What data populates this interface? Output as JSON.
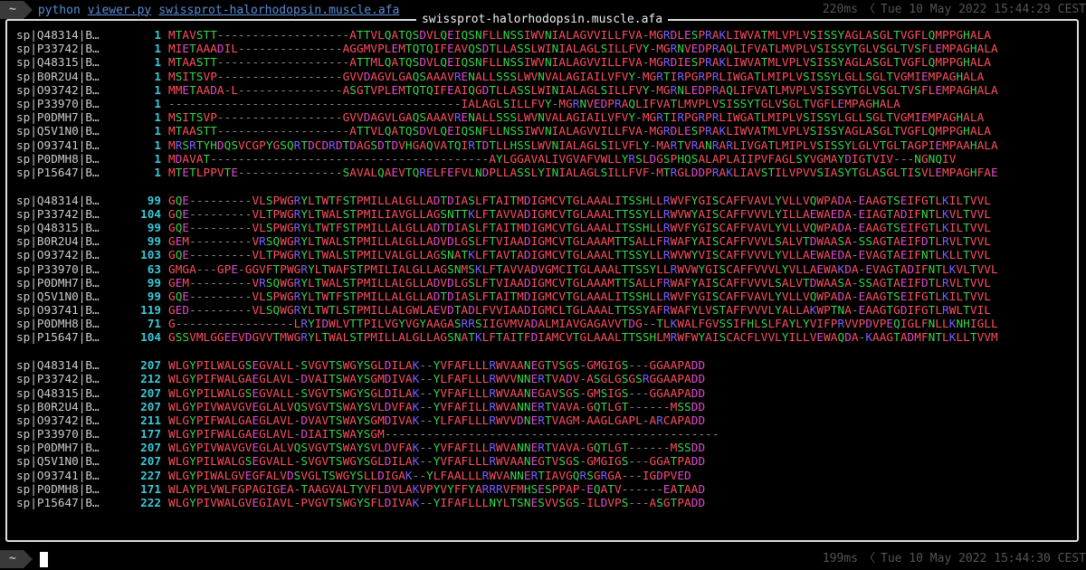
{
  "prompt": {
    "chip": "~",
    "program": "python",
    "script": "viewer.py",
    "file": "swissprot-halorhodopsin.muscle.afa"
  },
  "status_top": {
    "duration": "220ms",
    "timestamp": "Tue 10 May 2022 15:44:29 CEST"
  },
  "status_bottom": {
    "duration": "199ms",
    "timestamp": "Tue 10 May 2022 15:44:30 CEST"
  },
  "frame_title": "swissprot-halorhodopsin.muscle.afa",
  "colors": {
    "hydrophobic": "#ff4f5e",
    "polar": "#3bd34a",
    "positive": "#7a5cff",
    "negative": "#e04ad0",
    "gap": "#888888",
    "position": "#3ec7d6"
  },
  "blocks": [
    {
      "rows": [
        {
          "name": "sp|Q48314|B…",
          "pos": "1",
          "seq": "MTAVSTT-------------------ATTVLQATQSDVLQEIQSNFLLNSSIWVNIALAGVVILLFVA-MGRDLESPRAKLIWVATMLVPLVSISSYAGLASGLTVGFLQMPPGHALA"
        },
        {
          "name": "sp|P33742|B…",
          "pos": "1",
          "seq": "MIETAAADIL---------------AGGMVPLEMTQTQIFEAVQSDTLLASSLWINIALAGLSILLFVY-MGRNVEDPRAQLIFVATLMVPLVSISSYTGLVSGLTVSFLEMPAGHALA"
        },
        {
          "name": "sp|Q48315|B…",
          "pos": "1",
          "seq": "MTAASTT-------------------ATTMLQATQSDVLQEIQSNFLLNSSIWVNIALAGVVILLFVA-MGRDIESPRAKLIWVATMLVPLVSISSYAGLASGLTVGFLQMPPGHALA"
        },
        {
          "name": "sp|B0R2U4|B…",
          "pos": "1",
          "seq": "MSITSVP------------------GVVDAGVLGAQSAAAVRENALLSSSLWVNVALAGIAILVFVY-MGRTIRPGRPRLIWGATLMIPLVSISSYLGLLSGLTVGMIEMPAGHALA"
        },
        {
          "name": "sp|O93742|B…",
          "pos": "1",
          "seq": "MMETAADA-L---------------ASGTVPLEMTQTQIFEAIQGDTLLASSLWINIALAGLSILLFVY-MGRNLEDPRAQLIFVATLMVPLVSISSYTGLVSGLTVSFLEMPAGHALA"
        },
        {
          "name": "sp|P33970|B…",
          "pos": "1",
          "seq": "------------------------------------------IALAGLSILLFVY-MGRNVEDPRAQLIFVATLMVPLVSISSYTGLVSGLTVGFLEMPAGHALA"
        },
        {
          "name": "sp|P0DMH7|B…",
          "pos": "1",
          "seq": "MSITSVP------------------GVVDAGVLGAQSAAAVRENALLSSSLWVNVALAGIAILVFVY-MGRTIRPGRPRLIWGATLMIPLVSISSYLGLLSGLTVGMIEMPAGHALA"
        },
        {
          "name": "sp|Q5V1N0|B…",
          "pos": "1",
          "seq": "MTAASTT-------------------ATTVLQATQSDVLQEIQSNFLLNSSIWVNIALAGVVILLFVA-MGRDLESPRAKLIWVATMLVPLVSISSYAGLASGLTVGFLQMPPGHALA"
        },
        {
          "name": "sp|O93741|B…",
          "pos": "1",
          "seq": "MRSRTYHDQSVCGPYGSQRTDCDRDTDAGSDTDVHGAQVATQIRTDTLLHSSLWVNIALAGLSILVFLY-MARTVRANRARLIVGATLMIPLVSISSYLGLVTGLTAGPIEMPAAHALA"
        },
        {
          "name": "sp|P0DMH8|B…",
          "pos": "1",
          "seq": "MDAVAT----------------------------------------AYLGGAVALIVGVAFVWLLYRSLDGSPHQSALAPLAIIPVFAGLSYVGMAYDIGTVIV---NGNQIV"
        },
        {
          "name": "sp|P15647|B…",
          "pos": "1",
          "seq": "MTETLPPVTE---------------SAVALQAEVTQRELFEFVLNDPLLASSLYINIALAGLSILLFVF-MTRGLDDPRAKLIAVSTILVPVVSIASYTGLASGLTISVLEMPAGHFAE"
        }
      ]
    },
    {
      "rows": [
        {
          "name": "sp|Q48314|B…",
          "pos": "99",
          "seq": "GQE---------VLSPWGRYLTWTFSTPMILLALGLLADTDIASLFTAITMDIGMCVTGLAAALITSSHLLRWVFYGISCAFFVAVLYVLLVQWPADA-EAAGTSEIFGTLKILTVVL"
        },
        {
          "name": "sp|P33742|B…",
          "pos": "104",
          "seq": "GQE---------VLTPWGRYLTWALSTPMILIAVGLLAGSNTTKLFTAVVADIGMCVTGLAAALTTSSYLLRWVWYAISCAFFVVVLYILLAEWAEDA-EIAGTADIFNTLKVLTVVL"
        },
        {
          "name": "sp|Q48315|B…",
          "pos": "99",
          "seq": "GQE---------VLSPWGRYLTWTFSTPMILLALGLLADTDIASLFTAITMDIGMCVTGLAAALITSSHLLRWVFYGISCAFFVAVLYVLLVQWPADA-EAAGTSEIFGTLKILTVVL"
        },
        {
          "name": "sp|B0R2U4|B…",
          "pos": "99",
          "seq": "GEM---------VRSQWGRYLTWALSTPMILLALGLLADVDLGSLFTVIAADIGMCVTGLAAAMTTSALLFRWAFYAISCAFFVVVLSALVTDWAASA-SSAGTAEIFDTLRVLTVVL"
        },
        {
          "name": "sp|O93742|B…",
          "pos": "103",
          "seq": "GQE---------VLTPWGRYLTWALSTPMILVALGLLAGSNATKLFTAVTADIGMCVTGLAAALTTSSYLLRWVWYVISCAFFVVVLYVLLAEWAEDA-EVAGTAEIFNTLKLLTVVL"
        },
        {
          "name": "sp|P33970|B…",
          "pos": "63",
          "seq": "GMGA---GPE-GGVFTPWGRYLTWAFSTPMILIALGLLAGSNMSKLFTAVVADVGMCITGLAAALTTSSYLLRWVWYGISCAFFVVVLYVLLAEWAKDA-EVAGTADIFNTLKVLTVVL"
        },
        {
          "name": "sp|P0DMH7|B…",
          "pos": "99",
          "seq": "GEM---------VRSQWGRYLTWALSTPMILLALGLLADVDLGSLFTVIAADIGMCVTGLAAAMTTSALLFRWAFYAISCAFFVVVLSALVTDWAASA-SSAGTAEIFDTLRVLTVVL"
        },
        {
          "name": "sp|Q5V1N0|B…",
          "pos": "99",
          "seq": "GQE---------VLSPWGRYLTWTFSTPMILLALGLLADTDIASLFTAITMDIGMCVTGLAAALITSSHLLRWVFYGISCAFFVAVLYVLLVQWPADA-EAAGTSEIFGTLKILTVVL"
        },
        {
          "name": "sp|O93741|B…",
          "pos": "119",
          "seq": "GED---------VLSQWGRYLTWTLSTPMILLALGWLAEVDTADLFVVIAADIGMCLTGLAAALTTSSYAFRWAFYLVSTAFFVVVLYALLAKWPTNA-EAAGTGDIFGTLRWLTVIL"
        },
        {
          "name": "sp|P0DMH8|B…",
          "pos": "71",
          "seq": "G-----------------LRYIDWLVTTPILVGYVGYAAGASRRSIIGVMVADALMIAVGAGAVVTDG--TLKWALFGVSSIFHLSLFAYLYVIFPRVVPDVPEQIGLFNLLKNHIGLL"
        },
        {
          "name": "sp|P15647|B…",
          "pos": "104",
          "seq": "GSSVMLGGEEVDGVVTMWGRYLTWALSTPMILLALGLLAGSNATKLFTAITFDIAMCVTGLAAALTTSSHLMRWFWYAISCACFLVVLYILLVEWAQDA-KAAGTADMFNTLKLLTVVM"
        }
      ]
    },
    {
      "rows": [
        {
          "name": "sp|Q48314|B…",
          "pos": "207",
          "seq": "WLGYPILWALGSEGVALL-SVGVTSWGYSGLDILAK--YVFAFLLLRWVAANEGTVSGS-GMGIGS---GGAAPADD"
        },
        {
          "name": "sp|P33742|B…",
          "pos": "212",
          "seq": "WLGYPIFWALGAEGLAVL-DVAITSWAYSGMDIVAK--YLFAFLLLRWVVNNERTVADV-ASGLGSGSRGGAAPADD"
        },
        {
          "name": "sp|Q48315|B…",
          "pos": "207",
          "seq": "WLGYPILWALGSEGVALL-SVGVTSWGYSGLDILAK--YVFAFLLLRWVAANEGAVSGS-GMSIGS---GGAAPADD"
        },
        {
          "name": "sp|B0R2U4|B…",
          "pos": "207",
          "seq": "WLGYPIVWAVGVEGLALVQSVGVTSWAYSVLDVFAK--YVFAFILLRWVANNERTVAVA-GQTLGT------MSSDD"
        },
        {
          "name": "sp|O93742|B…",
          "pos": "211",
          "seq": "WLGYPIFWALGAEGLAVL-DVAVTSWAYSGMDIVAK--YLFAFLLLRWVVDNERTVAGM-AAGLGAPL-ARCAPADD"
        },
        {
          "name": "sp|P33970|B…",
          "pos": "177",
          "seq": "WLGYPIFWALGAEGLAVL-DIAITSWAYSGM------------------------------------------------"
        },
        {
          "name": "sp|P0DMH7|B…",
          "pos": "207",
          "seq": "WLGYPIVWAVGVEGLALVQSVGVTSWAYSVLDVFAK--YVFAFILLRWVANNERTVAVA-GQTLGT------MSSDD"
        },
        {
          "name": "sp|Q5V1N0|B…",
          "pos": "207",
          "seq": "WLGYPILWALGSEGVALL-SVGVTSWGYSGLDILAK--YVFAFLLLRWVAANEGTVSGS-GMGIGS---GGATPADD"
        },
        {
          "name": "sp|O93741|B…",
          "pos": "227",
          "seq": "WLGYPIWALGVEGFALVDSVGLTSWGYSLLDIGAK--YLFAALLLRWVANNERTIAVGQRSGRGA---IGDPVED"
        },
        {
          "name": "sp|P0DMH8|B…",
          "pos": "171",
          "seq": "WLAYPLVWLFGPAGIGEA-TAAGVALTYVFLDVLAKVPYVYFFYARRRVFMHSESPPAP-EQATV------EATAAD"
        },
        {
          "name": "sp|P15647|B…",
          "pos": "222",
          "seq": "WLGYPIVWALGVEGIAVL-PVGVTSWGYSFLDIVAK--YIFAFLLLNYLTSNESVVSGS-ILDVPS---ASGTPADD"
        }
      ]
    }
  ]
}
